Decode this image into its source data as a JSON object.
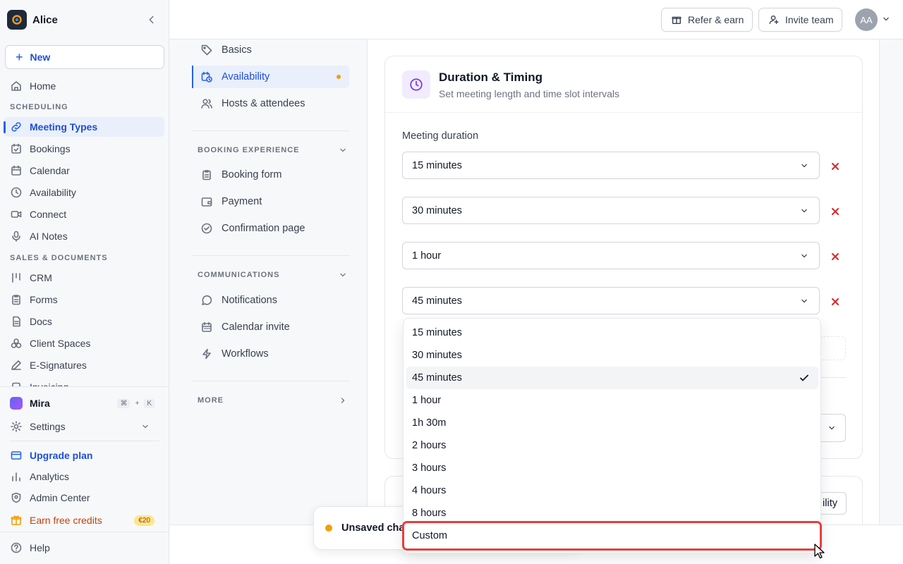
{
  "sidebar": {
    "workspace": "Alice",
    "new_label": "New",
    "home": "Home",
    "section_scheduling": "SCHEDULING",
    "scheduling": [
      "Meeting Types",
      "Bookings",
      "Calendar",
      "Availability",
      "Connect",
      "AI Notes"
    ],
    "section_sales": "SALES & DOCUMENTS",
    "sales": [
      "CRM",
      "Forms",
      "Docs",
      "Client Spaces",
      "E-Signatures",
      "Invoicing"
    ],
    "mira": "Mira",
    "mira_kbd": [
      "⌘",
      "+",
      "K"
    ],
    "settings": "Settings",
    "upgrade": "Upgrade plan",
    "analytics": "Analytics",
    "admin": "Admin Center",
    "earn": "Earn free credits",
    "earn_badge": "€20",
    "help": "Help",
    "accent": "#2563eb"
  },
  "topbar": {
    "refer": "Refer & earn",
    "invite": "Invite team",
    "avatar": "AA"
  },
  "subnav": {
    "basics": "Basics",
    "availability": "Availability",
    "hosts": "Hosts & attendees",
    "booking_experience": "BOOKING EXPERIENCE",
    "booking_form": "Booking form",
    "payment": "Payment",
    "confirmation": "Confirmation page",
    "communications": "COMMUNICATIONS",
    "notifications": "Notifications",
    "calendar_invite": "Calendar invite",
    "workflows": "Workflows",
    "more": "MORE"
  },
  "card": {
    "title": "Duration & Timing",
    "subtitle": "Set meeting length and time slot intervals",
    "duration_label": "Meeting duration",
    "durations": [
      "15 minutes",
      "30 minutes",
      "1 hour",
      "45 minutes"
    ]
  },
  "card2_button_fragment": "ility",
  "dropdown": {
    "options": [
      "15 minutes",
      "30 minutes",
      "45 minutes",
      "1 hour",
      "1h 30m",
      "2 hours",
      "3 hours",
      "4 hours",
      "8 hours",
      "Custom"
    ],
    "selected": "45 minutes"
  },
  "toast": "Unsaved cha"
}
